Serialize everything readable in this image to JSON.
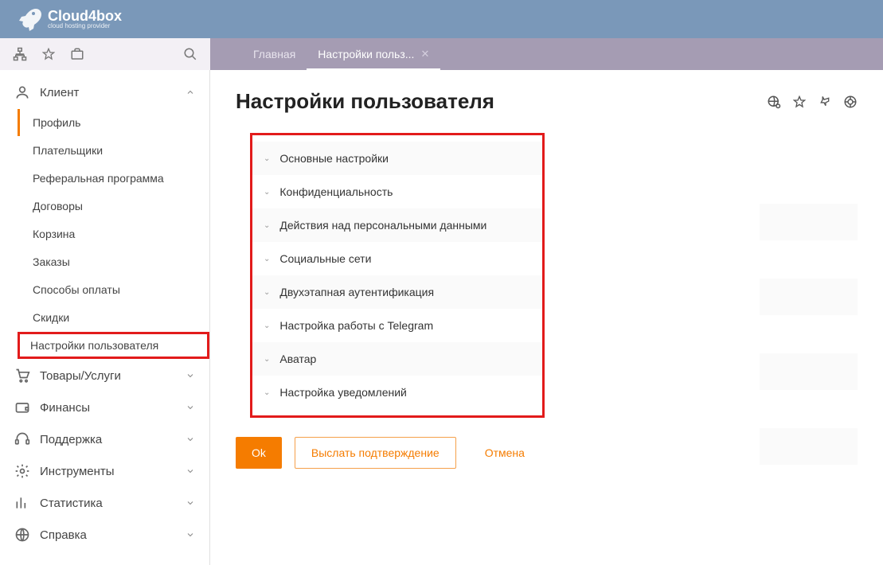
{
  "brand": {
    "name": "Cloud4box",
    "tagline": "cloud hosting provider"
  },
  "tabs": [
    {
      "label": "Главная",
      "active": false,
      "closable": false
    },
    {
      "label": "Настройки польз...",
      "active": true,
      "closable": true
    }
  ],
  "sidebar": {
    "client": {
      "label": "Клиент",
      "items": [
        {
          "label": "Профиль"
        },
        {
          "label": "Плательщики"
        },
        {
          "label": "Реферальная программа"
        },
        {
          "label": "Договоры"
        },
        {
          "label": "Корзина"
        },
        {
          "label": "Заказы"
        },
        {
          "label": "Способы оплаты"
        },
        {
          "label": "Скидки"
        },
        {
          "label": "Настройки пользователя"
        }
      ]
    },
    "groups": [
      {
        "label": "Товары/Услуги",
        "icon": "cart"
      },
      {
        "label": "Финансы",
        "icon": "wallet"
      },
      {
        "label": "Поддержка",
        "icon": "headset"
      },
      {
        "label": "Инструменты",
        "icon": "gear"
      },
      {
        "label": "Статистика",
        "icon": "chart"
      },
      {
        "label": "Справка",
        "icon": "globe"
      }
    ]
  },
  "page": {
    "title": "Настройки пользователя",
    "sections": [
      {
        "label": "Основные настройки"
      },
      {
        "label": "Конфиденциальность"
      },
      {
        "label": "Действия над персональными данными"
      },
      {
        "label": "Социальные сети"
      },
      {
        "label": "Двухэтапная аутентификация"
      },
      {
        "label": "Настройка работы с Telegram"
      },
      {
        "label": "Аватар"
      },
      {
        "label": "Настройка уведомлений"
      }
    ],
    "buttons": {
      "ok": "Ok",
      "resend": "Выслать подтверждение",
      "cancel": "Отмена"
    }
  }
}
